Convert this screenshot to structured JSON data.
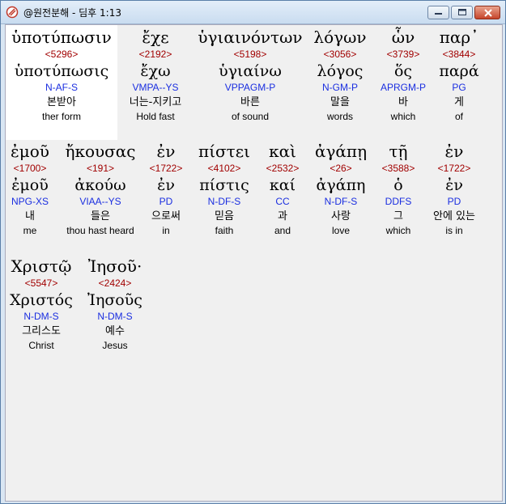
{
  "window": {
    "title": "@원전분해 - 딤후 1:13",
    "controls": {
      "minimize": "minimize-icon",
      "maximize": "maximize-icon",
      "close": "close-icon"
    }
  },
  "colors": {
    "strong": "#a10000",
    "morph": "#1a2ee0",
    "text": "#000000",
    "background": "#f0f0f0",
    "highlight": "#ffffff"
  },
  "words": [
    {
      "greek": "ὑποτύπωσιν",
      "strong": "<5296>",
      "lemma": "ὑποτύπωσις",
      "morph": "N-AF-S",
      "korean": "본받아",
      "english": "ther form"
    },
    {
      "greek": "ἔχε",
      "strong": "<2192>",
      "lemma": "ἔχω",
      "morph": "VMPA--YS",
      "korean": "너는-지키고",
      "english": "Hold fast"
    },
    {
      "greek": "ὑγιαινόντων",
      "strong": "<5198>",
      "lemma": "ὑγιαίνω",
      "morph": "VPPAGM-P",
      "korean": "바른",
      "english": "of sound"
    },
    {
      "greek": "λόγων",
      "strong": "<3056>",
      "lemma": "λόγος",
      "morph": "N-GM-P",
      "korean": "말을",
      "english": "words"
    },
    {
      "greek": "ὧν",
      "strong": "<3739>",
      "lemma": "ὅς",
      "morph": "APRGM-P",
      "korean": "바",
      "english": "which"
    },
    {
      "greek": "παρ᾽",
      "strong": "<3844>",
      "lemma": "παρά",
      "morph": "PG",
      "korean": "게",
      "english": "of"
    },
    {
      "greek": "ἐμοῦ",
      "strong": "<1700>",
      "lemma": "ἐμοῦ",
      "morph": "NPG-XS",
      "korean": "내",
      "english": "me"
    },
    {
      "greek": "ἤκουσας",
      "strong": "<191>",
      "lemma": "ἀκούω",
      "morph": "VIAA--YS",
      "korean": "들은",
      "english": "thou hast heard"
    },
    {
      "greek": "ἐν",
      "strong": "<1722>",
      "lemma": "ἐν",
      "morph": "PD",
      "korean": "으로써",
      "english": "in"
    },
    {
      "greek": "πίστει",
      "strong": "<4102>",
      "lemma": "πίστις",
      "morph": "N-DF-S",
      "korean": "믿음",
      "english": "faith"
    },
    {
      "greek": "καὶ",
      "strong": "<2532>",
      "lemma": "καί",
      "morph": "CC",
      "korean": "과",
      "english": "and"
    },
    {
      "greek": "ἀγάπῃ",
      "strong": "<26>",
      "lemma": "ἀγάπη",
      "morph": "N-DF-S",
      "korean": "사랑",
      "english": "love"
    },
    {
      "greek": "τῇ",
      "strong": "<3588>",
      "lemma": "ὁ",
      "morph": "DDFS",
      "korean": "그",
      "english": "which"
    },
    {
      "greek": "ἐν",
      "strong": "<1722>",
      "lemma": "ἐν",
      "morph": "PD",
      "korean": "안에 있는",
      "english": "is in"
    },
    {
      "greek": "Χριστῷ",
      "strong": "<5547>",
      "lemma": "Χριστός",
      "morph": "N-DM-S",
      "korean": "그리스도",
      "english": "Christ"
    },
    {
      "greek": "Ἰησοῦ·",
      "strong": "<2424>",
      "lemma": "Ἰησοῦς",
      "morph": "N-DM-S",
      "korean": "예수",
      "english": "Jesus"
    }
  ]
}
